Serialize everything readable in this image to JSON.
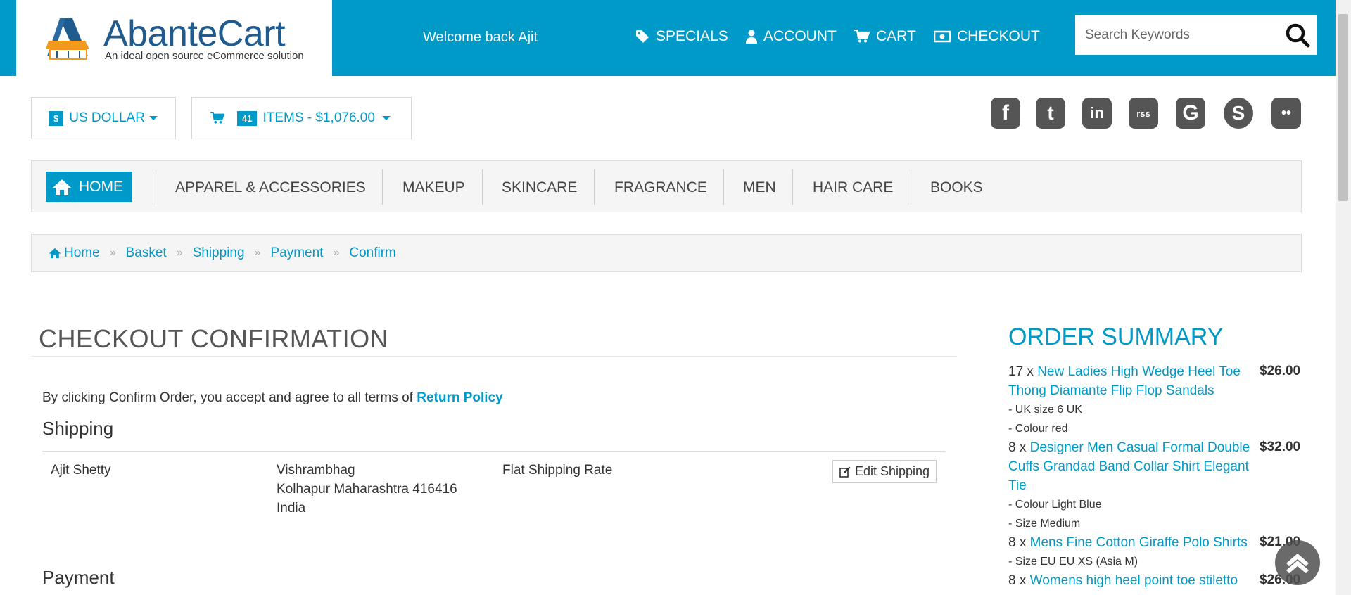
{
  "brand": {
    "name": "AbanteCart",
    "tagline": "An ideal open source eCommerce solution",
    "colors": {
      "primary": "#009ac9",
      "logo_text": "#1f5b8e"
    }
  },
  "header": {
    "welcome": "Welcome back Ajit",
    "nav": [
      {
        "label": "SPECIALS",
        "icon": "tag-icon"
      },
      {
        "label": "ACCOUNT",
        "icon": "user-icon"
      },
      {
        "label": "CART",
        "icon": "cart-icon"
      },
      {
        "label": "CHECKOUT",
        "icon": "money-icon"
      }
    ],
    "search": {
      "placeholder": "Search Keywords",
      "value": ""
    }
  },
  "toolbar": {
    "currency_symbol": "$",
    "currency_label": "US DOLLAR",
    "cart_count": "41",
    "cart_label": "ITEMS - $1,076.00"
  },
  "social": [
    {
      "name": "facebook",
      "glyph": "f"
    },
    {
      "name": "twitter",
      "glyph": "t"
    },
    {
      "name": "linkedin",
      "glyph": "in"
    },
    {
      "name": "rss",
      "glyph": "rss"
    },
    {
      "name": "google",
      "glyph": "G"
    },
    {
      "name": "skype",
      "glyph": "S"
    },
    {
      "name": "flickr",
      "glyph": "••"
    }
  ],
  "categories": {
    "home": "HOME",
    "items": [
      "APPAREL & ACCESSORIES",
      "MAKEUP",
      "SKINCARE",
      "FRAGRANCE",
      "MEN",
      "HAIR CARE",
      "BOOKS"
    ]
  },
  "breadcrumb": [
    "Home",
    "Basket",
    "Shipping",
    "Payment",
    "Confirm"
  ],
  "main": {
    "title": "CHECKOUT CONFIRMATION",
    "terms_text": "By clicking Confirm Order, you accept and agree to all terms of",
    "terms_link": "Return Policy",
    "shipping_heading": "Shipping",
    "shipping": {
      "name": "Ajit Shetty",
      "address_line1": "Vishrambhag",
      "address_line2": "Kolhapur Maharashtra 416416",
      "address_line3": "India",
      "method": "Flat Shipping Rate",
      "edit_label": "Edit Shipping"
    },
    "payment_heading": "Payment"
  },
  "summary": {
    "title": "ORDER SUMMARY",
    "items": [
      {
        "qty": "17 x",
        "name_l1": "New Ladies High Wedge Heel Toe",
        "name_l2": "Thong Diamante Flip Flop Sandals",
        "name_l3": "",
        "price": "$26.00",
        "options": [
          "UK size 6 UK",
          "Colour red"
        ]
      },
      {
        "qty": "8 x",
        "name_l1": "Designer Men Casual Formal Double",
        "name_l2": "Cuffs Grandad Band Collar Shirt Elegant",
        "name_l3": "Tie",
        "price": "$32.00",
        "options": [
          "Colour Light Blue",
          "Size Medium"
        ]
      },
      {
        "qty": "8 x",
        "name_l1": "Mens Fine Cotton Giraffe Polo Shirts",
        "name_l2": "",
        "name_l3": "",
        "price": "$21.00",
        "options": [
          "Size EU EU XS (Asia M)"
        ]
      },
      {
        "qty": "8 x",
        "name_l1": "Womens high heel point toe stiletto",
        "name_l2": "",
        "name_l3": "",
        "price": "$26.00",
        "options": []
      }
    ]
  }
}
